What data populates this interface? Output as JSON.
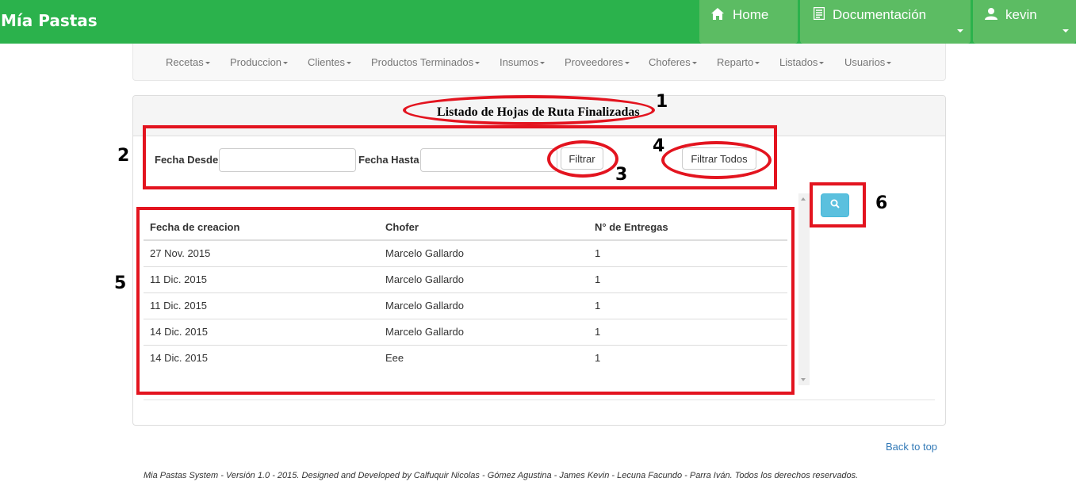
{
  "app": {
    "brand": "Mía Pastas"
  },
  "topnav": {
    "home": "Home",
    "docs": "Documentación",
    "user": "kevin"
  },
  "menu": [
    "Recetas",
    "Produccion",
    "Clientes",
    "Productos Terminados",
    "Insumos",
    "Proveedores",
    "Choferes",
    "Reparto",
    "Listados",
    "Usuarios"
  ],
  "panel": {
    "title": "Listado de Hojas de Ruta Finalizadas"
  },
  "filters": {
    "fecha_desde_label": "Fecha Desde",
    "fecha_desde_value": "",
    "fecha_hasta_label": "Fecha Hasta",
    "fecha_hasta_value": "",
    "filtrar_label": "Filtrar",
    "filtrar_todos_label": "Filtrar Todos"
  },
  "table": {
    "headers": [
      "Fecha de creacion",
      "Chofer",
      "N° de Entregas"
    ],
    "rows": [
      [
        "27 Nov. 2015",
        "Marcelo Gallardo",
        "1"
      ],
      [
        "11 Dic. 2015",
        "Marcelo Gallardo",
        "1"
      ],
      [
        "11 Dic. 2015",
        "Marcelo Gallardo",
        "1"
      ],
      [
        "14 Dic. 2015",
        "Marcelo Gallardo",
        "1"
      ],
      [
        "14 Dic. 2015",
        "Eee",
        "1"
      ]
    ]
  },
  "links": {
    "back_to_top": "Back to top"
  },
  "footer": {
    "text": "Mia Pastas System - Versión 1.0 - 2015. Designed and Developed by Calfuquir Nicolas - Gómez Agustina - James Kevin - Lecuna Facundo - Parra Iván. Todos los derechos reservados."
  },
  "annotations": [
    "1",
    "2",
    "3",
    "4",
    "5",
    "6"
  ],
  "icons": {
    "home": "home-icon",
    "docs": "document-icon",
    "user": "user-icon",
    "search": "search-icon"
  },
  "colors": {
    "navbar": "#2bb24c",
    "navbar_button": "#5cbc63",
    "annotation": "#e3141f",
    "search_button": "#5bc0de",
    "link": "#337ab7"
  }
}
